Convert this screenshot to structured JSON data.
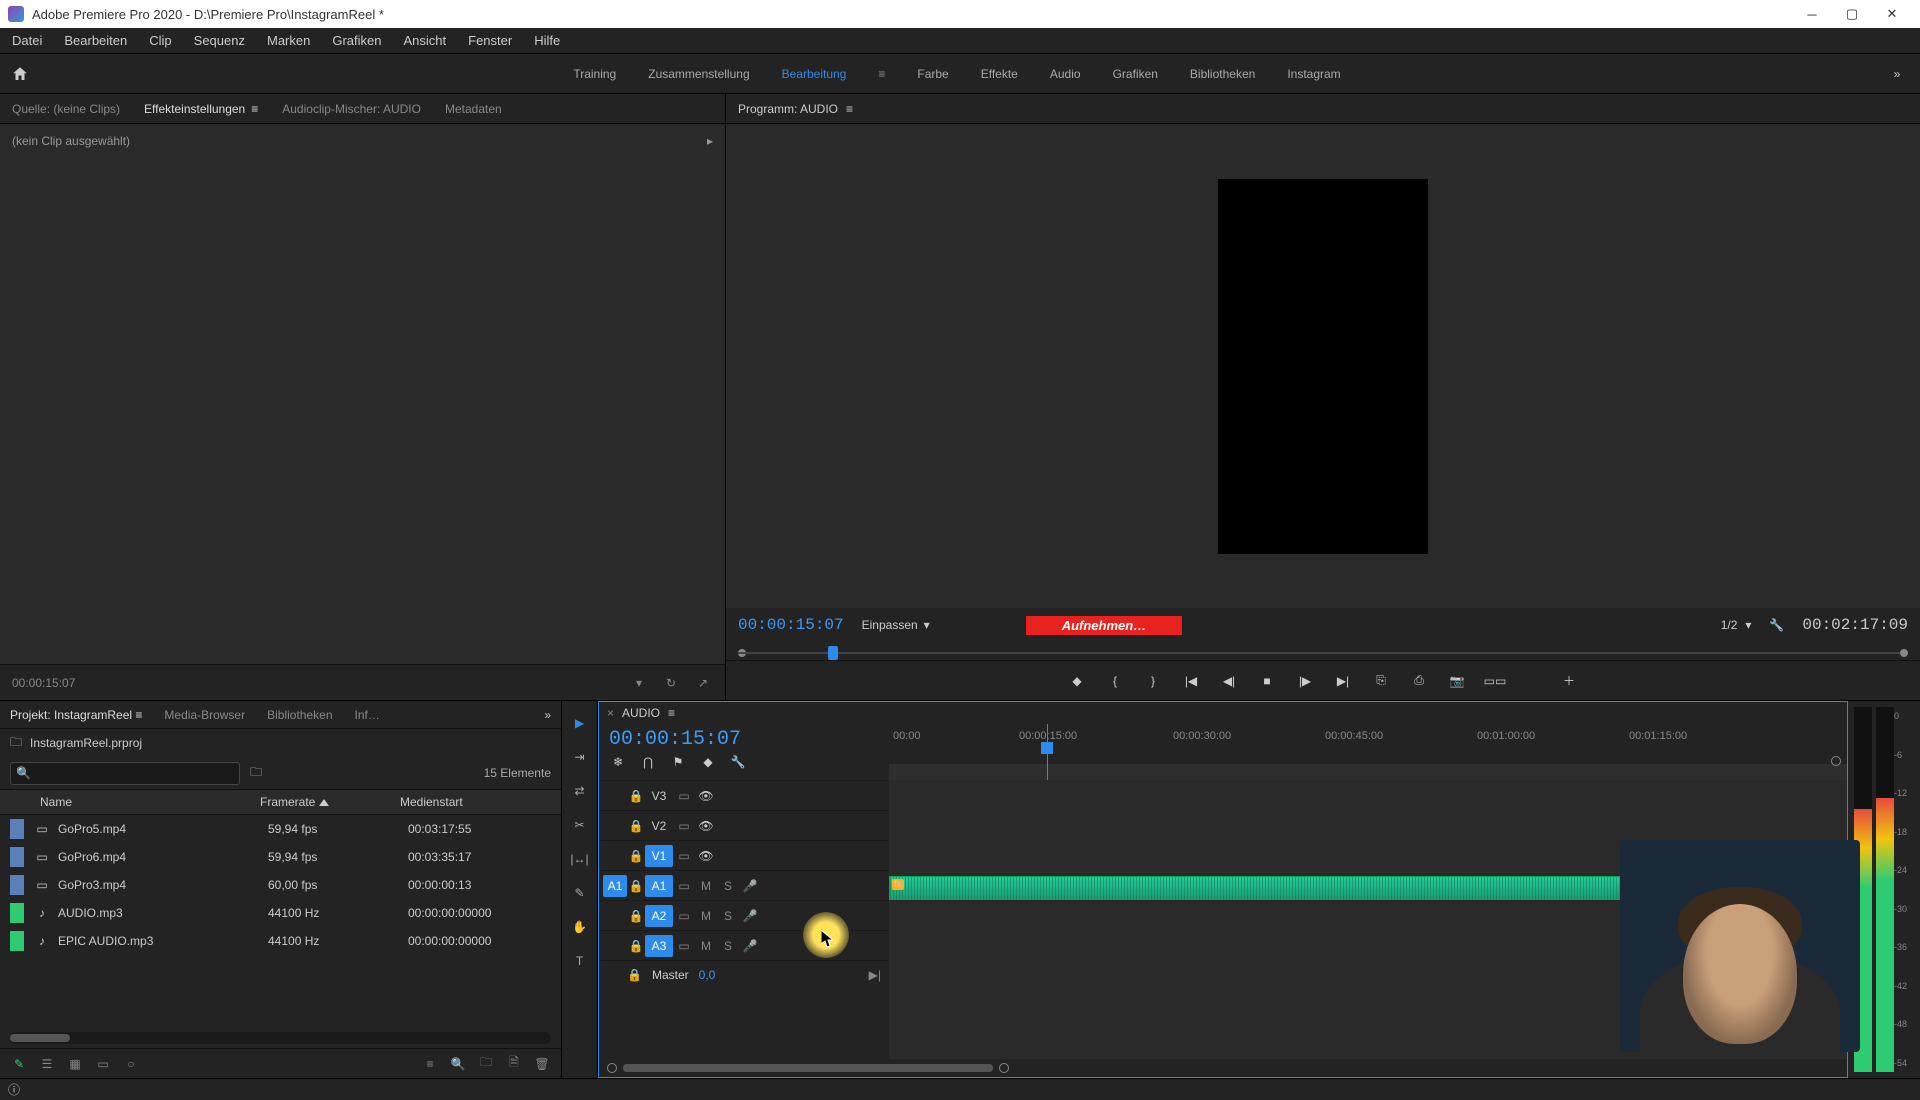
{
  "titlebar": {
    "title": "Adobe Premiere Pro 2020 - D:\\Premiere Pro\\InstagramReel *"
  },
  "menubar": [
    "Datei",
    "Bearbeiten",
    "Clip",
    "Sequenz",
    "Marken",
    "Grafiken",
    "Ansicht",
    "Fenster",
    "Hilfe"
  ],
  "workspaces": {
    "items": [
      "Training",
      "Zusammenstellung",
      "Bearbeitung",
      "Farbe",
      "Effekte",
      "Audio",
      "Grafiken",
      "Bibliotheken",
      "Instagram"
    ],
    "active": 2
  },
  "source_tabs": {
    "items": [
      "Quelle: (keine Clips)",
      "Effekteinstellungen",
      "Audioclip-Mischer: AUDIO",
      "Metadaten"
    ],
    "active": 1,
    "no_clip": "(kein Clip ausgewählt)",
    "footer_tc": "00:00:15:07"
  },
  "program": {
    "label": "Programm: AUDIO",
    "tc_left": "00:00:15:07",
    "tc_right": "00:02:17:09",
    "fit": "Einpassen",
    "rec": "Aufnehmen…",
    "scale": "1/2"
  },
  "project": {
    "tabs": [
      "Projekt: InstagramReel",
      "Media-Browser",
      "Bibliotheken",
      "Inf…"
    ],
    "active": 0,
    "file": "InstagramReel.prproj",
    "elements": "15 Elemente",
    "cols": {
      "name": "Name",
      "framerate": "Framerate",
      "medienstart": "Medienstart"
    },
    "rows": [
      {
        "swatch": "#5b7fb8",
        "kind": "video",
        "name": "GoPro5.mp4",
        "fr": "59,94 fps",
        "ms": "00:03:17:55"
      },
      {
        "swatch": "#5b7fb8",
        "kind": "video",
        "name": "GoPro6.mp4",
        "fr": "59,94 fps",
        "ms": "00:03:35:17"
      },
      {
        "swatch": "#5b7fb8",
        "kind": "video",
        "name": "GoPro3.mp4",
        "fr": "60,00 fps",
        "ms": "00:00:00:13"
      },
      {
        "swatch": "#2ecc71",
        "kind": "audio",
        "name": "AUDIO.mp3",
        "fr": "44100 Hz",
        "ms": "00:00:00:00000"
      },
      {
        "swatch": "#2ecc71",
        "kind": "audio",
        "name": "EPIC AUDIO.mp3",
        "fr": "44100 Hz",
        "ms": "00:00:00:00000"
      }
    ]
  },
  "timeline": {
    "seq_name": "AUDIO",
    "tc": "00:00:15:07",
    "ruler": [
      "00:00",
      "00:00:15:00",
      "00:00:30:00",
      "00:00:45:00",
      "00:01:00:00",
      "00:01:15:00"
    ],
    "tracks": {
      "video": [
        "V3",
        "V2",
        "V1"
      ],
      "audio": [
        "A1",
        "A2",
        "A3"
      ]
    },
    "master": {
      "label": "Master",
      "value": "0,0"
    }
  },
  "meters": {
    "ticks": [
      "0",
      "-6",
      "-12",
      "-18",
      "-24",
      "-30",
      "-36",
      "-42",
      "-48",
      "-54"
    ],
    "levels": [
      0.72,
      0.75
    ]
  }
}
